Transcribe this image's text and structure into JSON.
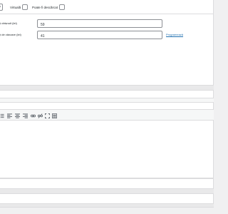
{
  "product_type": {
    "virtual_label": "Virtuală",
    "downloadable_label": "Poate fi descărcat"
  },
  "pricing": {
    "regular_price_label": "ț obișnuit (lei)",
    "regular_price_value": "59",
    "sale_price_label": "ț de vânzare (lei)",
    "sale_price_value": "41",
    "schedule_link": "Programează"
  },
  "editor": {
    "toolbar_icons": [
      "bulleted-list-icon",
      "align-left-icon",
      "align-center-icon",
      "align-right-icon",
      "insert-link-icon",
      "remove-link-icon",
      "fullscreen-icon",
      "toolbar-toggle-icon"
    ]
  },
  "colors": {
    "link": "#2271b1",
    "border": "#dcdcde",
    "background": "#f0f0f1"
  }
}
